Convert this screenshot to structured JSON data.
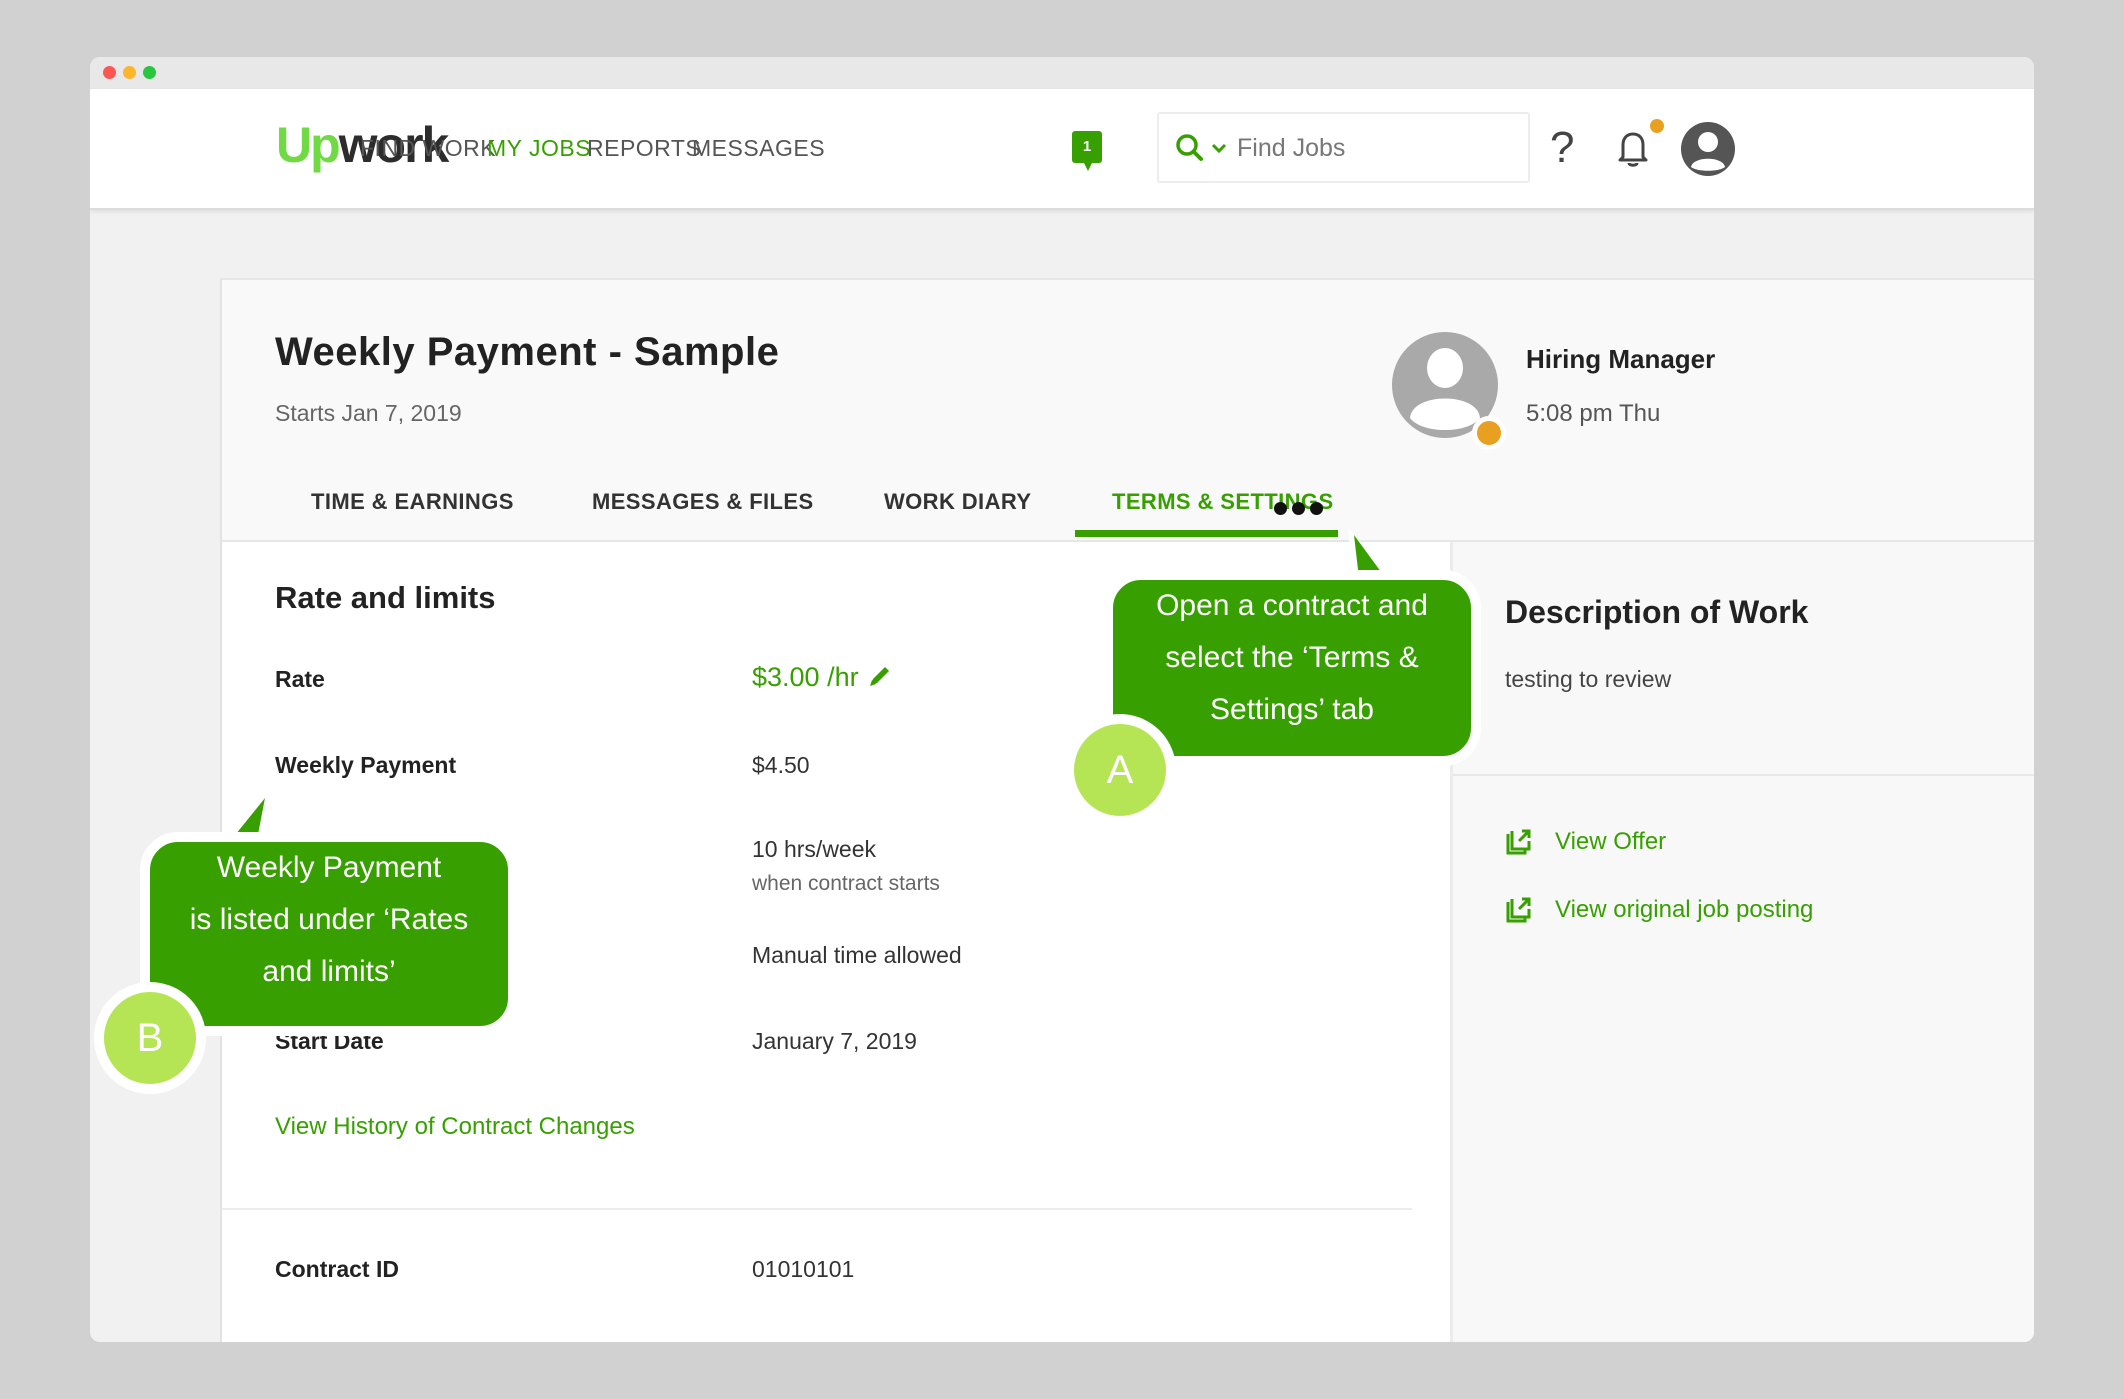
{
  "window": {
    "traffic_lights": [
      "close",
      "minimize",
      "maximize"
    ]
  },
  "header": {
    "logo_up": "Up",
    "logo_work": "work",
    "nav": [
      {
        "label": "FIND WORK",
        "active": false
      },
      {
        "label": "MY JOBS",
        "active": true
      },
      {
        "label": "REPORTS",
        "active": false
      },
      {
        "label": "MESSAGES",
        "active": false
      }
    ],
    "messages_badge": "1",
    "search": {
      "placeholder": "Find Jobs",
      "value": "",
      "icon": "search-icon",
      "dropdown_icon": "chevron-down-icon"
    },
    "help_label": "?",
    "notification_dot": true,
    "colors": {
      "brand_green": "#6fda44",
      "accent_green": "#37a000",
      "notification": "#e8a021"
    }
  },
  "contract": {
    "title": "Weekly Payment - Sample",
    "starts": "Starts Jan 7, 2019",
    "hiring_manager": {
      "name": "Hiring Manager",
      "local_time": "5:08 pm Thu",
      "status": "away"
    },
    "tabs": [
      {
        "label": "TIME & EARNINGS",
        "active": false
      },
      {
        "label": "MESSAGES & FILES",
        "active": false
      },
      {
        "label": "WORK DIARY",
        "active": false
      },
      {
        "label": "TERMS & SETTINGS",
        "active": true
      }
    ],
    "more_tabs_label": "•••"
  },
  "rate_and_limits": {
    "title": "Rate and limits",
    "rows": [
      {
        "label": "Rate",
        "value": "$3.00 /hr"
      },
      {
        "label": "Weekly Payment",
        "value": "$4.50"
      },
      {
        "label": "",
        "value": "10 hrs/week",
        "sub": "when contract starts"
      },
      {
        "label": "",
        "value": "Manual time allowed"
      },
      {
        "label": "Start Date",
        "value": "January 7, 2019"
      }
    ],
    "history_link": "View History of Contract Changes"
  },
  "contract_id": {
    "label": "Contract ID",
    "value": "01010101"
  },
  "sidebar": {
    "description_title": "Description of Work",
    "description_text": "testing to review",
    "links": [
      {
        "label": "View Offer",
        "icon": "external-link-icon"
      },
      {
        "label": "View original job posting",
        "icon": "external-link-icon"
      }
    ]
  },
  "callouts": {
    "a": {
      "badge": "A",
      "text_lines": [
        "Open a contract and",
        "select the ‘Terms &",
        "Settings’ tab"
      ]
    },
    "b": {
      "badge": "B",
      "text_lines": [
        "Weekly Payment",
        "is listed under ‘Rates",
        "and limits’"
      ]
    },
    "colors": {
      "bubble": "#37a000",
      "badge": "#b5e554"
    }
  }
}
